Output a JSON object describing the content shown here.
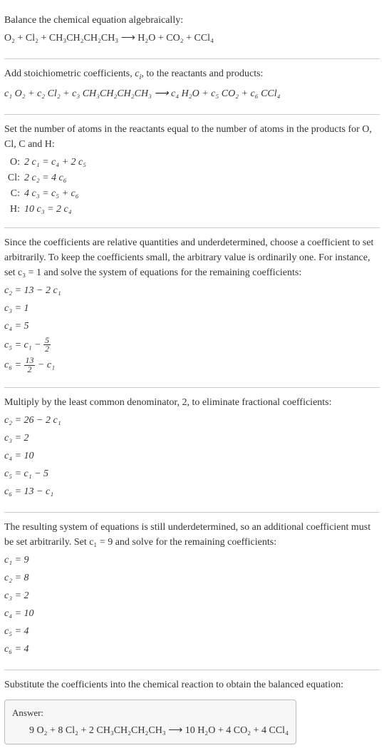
{
  "section1": {
    "text": "Balance the chemical equation algebraically:",
    "equation": "O₂ + Cl₂ + CH₃CH₂CH₂CH₃ ⟶ H₂O + CO₂ + CCl₄"
  },
  "section2": {
    "text_part1": "Add stoichiometric coefficients, ",
    "text_ci": "c",
    "text_ci_sub": "i",
    "text_part2": ", to the reactants and products:",
    "equation": "c₁ O₂ + c₂ Cl₂ + c₃ CH₃CH₂CH₂CH₃ ⟶ c₄ H₂O + c₅ CO₂ + c₆ CCl₄"
  },
  "section3": {
    "text": "Set the number of atoms in the reactants equal to the number of atoms in the products for O, Cl, C and H:",
    "rows": [
      {
        "label": "O:",
        "eq": "2 c₁ = c₄ + 2 c₅"
      },
      {
        "label": "Cl:",
        "eq": "2 c₂ = 4 c₆"
      },
      {
        "label": "C:",
        "eq": "4 c₃ = c₅ + c₆"
      },
      {
        "label": "H:",
        "eq": "10 c₃ = 2 c₄"
      }
    ]
  },
  "section4": {
    "text": "Since the coefficients are relative quantities and underdetermined, choose a coefficient to set arbitrarily. To keep the coefficients small, the arbitrary value is ordinarily one. For instance, set c₃ = 1 and solve the system of equations for the remaining coefficients:",
    "lines": {
      "l1": "c₂ = 13 − 2 c₁",
      "l2": "c₃ = 1",
      "l3": "c₄ = 5",
      "l4_pre": "c₅ = c₁ − ",
      "l4_num": "5",
      "l4_den": "2",
      "l5_pre": "c₆ = ",
      "l5_num": "13",
      "l5_den": "2",
      "l5_post": " − c₁"
    }
  },
  "section5": {
    "text": "Multiply by the least common denominator, 2, to eliminate fractional coefficients:",
    "lines": [
      "c₂ = 26 − 2 c₁",
      "c₃ = 2",
      "c₄ = 10",
      "c₅ = c₁ − 5",
      "c₆ = 13 − c₁"
    ]
  },
  "section6": {
    "text": "The resulting system of equations is still underdetermined, so an additional coefficient must be set arbitrarily. Set c₁ = 9 and solve for the remaining coefficients:",
    "lines": [
      "c₁ = 9",
      "c₂ = 8",
      "c₃ = 2",
      "c₄ = 10",
      "c₅ = 4",
      "c₆ = 4"
    ]
  },
  "section7": {
    "text": "Substitute the coefficients into the chemical reaction to obtain the balanced equation:",
    "answer_label": "Answer:",
    "answer_eq": "9 O₂ + 8 Cl₂ + 2 CH₃CH₂CH₂CH₃ ⟶ 10 H₂O + 4 CO₂ + 4 CCl₄"
  }
}
